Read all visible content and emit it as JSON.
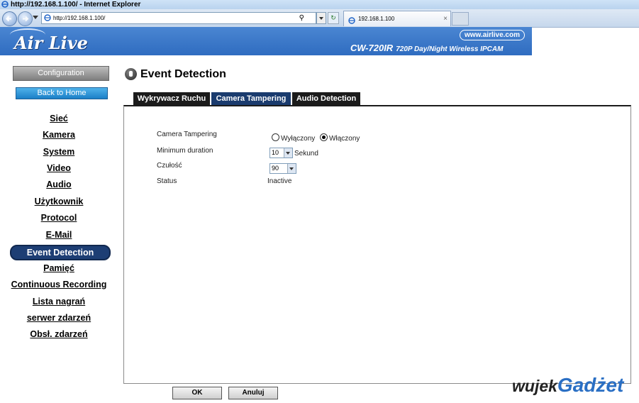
{
  "browser": {
    "title": "http://192.168.1.100/ - Internet Explorer",
    "address": "http://192.168.1.100/",
    "tab_label": "192.168.1.100",
    "tab_close": "×"
  },
  "banner": {
    "logo": "Air Live",
    "site_url": "www.airlive.com",
    "model": "CW-720IR",
    "model_sub": "720P Day/Night Wireless IPCAM"
  },
  "sidebar": {
    "config_label": "Configuration",
    "home_label": "Back to Home",
    "items": [
      {
        "label": "Sieć"
      },
      {
        "label": "Kamera"
      },
      {
        "label": "System"
      },
      {
        "label": "Video"
      },
      {
        "label": "Audio"
      },
      {
        "label": "Użytkownik"
      },
      {
        "label": "Protocol"
      },
      {
        "label": "E-Mail"
      },
      {
        "label": "Event Detection",
        "active": true
      },
      {
        "label": "Pamięć"
      },
      {
        "label": "Continuous Recording"
      },
      {
        "label": "Lista nagrań"
      },
      {
        "label": "serwer zdarzeń"
      },
      {
        "label": "Obsł. zdarzeń"
      }
    ]
  },
  "main": {
    "title": "Event Detection",
    "tabs": [
      {
        "label": "Wykrywacz Ruchu"
      },
      {
        "label": "Camera Tampering",
        "active": true
      },
      {
        "label": "Audio Detection"
      }
    ],
    "form": {
      "tampering_label": "Camera Tampering",
      "radio_off": "Wyłączony",
      "radio_on": "Włączony",
      "selected": "Włączony",
      "duration_label": "Minimum duration",
      "duration_value": "10",
      "duration_unit": "Sekund",
      "sensitivity_label": "Czułość",
      "sensitivity_value": "90",
      "status_label": "Status",
      "status_value": "Inactive"
    },
    "ok_label": "OK",
    "cancel_label": "Anuluj"
  },
  "watermark": {
    "part1": "wujek",
    "part2": "Gadżet"
  },
  "colors": {
    "banner": "#2f6cc0",
    "active_nav": "#1d3e74",
    "active_tab": "#1a3b6e"
  }
}
